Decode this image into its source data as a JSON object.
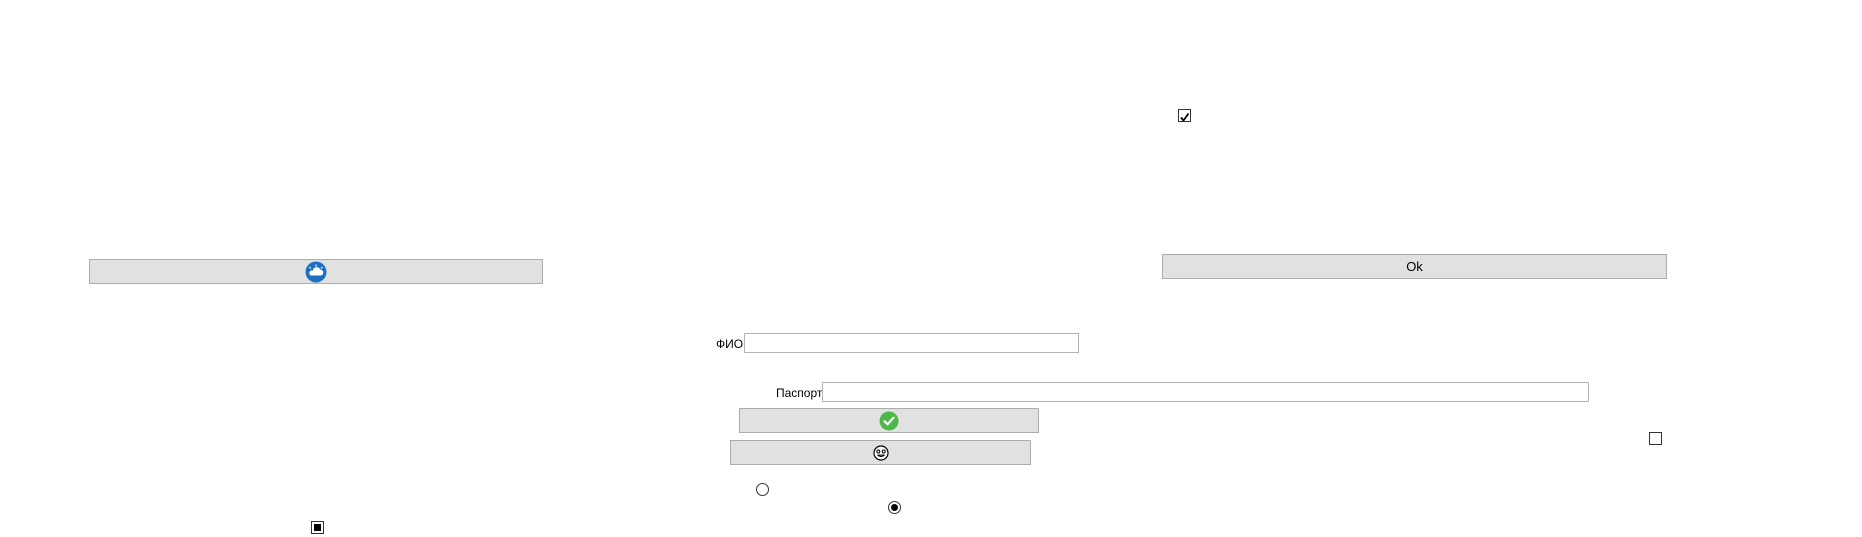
{
  "form": {
    "ok_button_label": "Ok",
    "fio_label": "ФИО",
    "fio_value": "",
    "passport_label": "Паспорт",
    "passport_value": ""
  },
  "controls": {
    "top_checkbox_checked": true,
    "right_checkbox_checked": false,
    "bottom_left_checkbox_state": "indeterminate",
    "radio_1_checked": false,
    "radio_2_checked": true
  },
  "icons": {
    "cloud_button_icon": "cloud-icon",
    "confirm_button_icon": "check-circle-icon",
    "face_button_icon": "face-icon"
  },
  "colors": {
    "button_bg": "#e1e1e1",
    "cloud_blue": "#1e6fc0",
    "check_green": "#4cb848"
  }
}
